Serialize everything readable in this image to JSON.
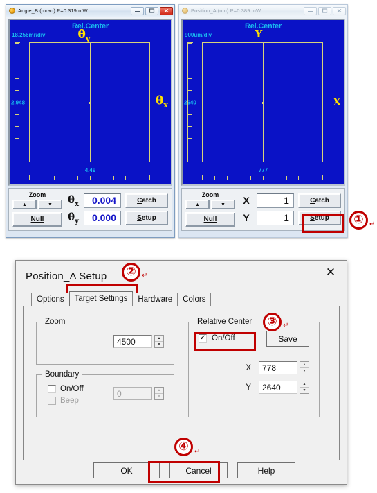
{
  "windows": [
    {
      "id": "angle_b",
      "title": "Angle_B  (mrad)    P=0.319 mW",
      "active": true,
      "scope": {
        "rel_center": "Rel.Center",
        "scale": "18.256mr/div",
        "top_axis_letter": "θ",
        "top_axis_sub": "y",
        "right_axis_letter": "θ",
        "right_axis_sub": "x",
        "y_value": "2.948",
        "x_value": "4.49"
      },
      "panel": {
        "zoom_label": "Zoom",
        "zoom_up": "▲",
        "zoom_down": "▼",
        "null_label": "Null",
        "row1_symbol": "θ",
        "row1_sub": "x",
        "row1_value": "0.004",
        "row2_symbol": "θ",
        "row2_sub": "y",
        "row2_value": "0.000",
        "catch_label": "Catch",
        "setup_label": "Setup"
      }
    },
    {
      "id": "position_a",
      "title": "Position_A  (um)    P=0.389 mW",
      "active": false,
      "scope": {
        "rel_center": "Rel.Center",
        "scale": "900um/div",
        "top_axis_letter": "Y",
        "top_axis_sub": "",
        "right_axis_letter": "X",
        "right_axis_sub": "",
        "y_value": "2640",
        "x_value": "777"
      },
      "panel": {
        "zoom_label": "Zoom",
        "zoom_up": "▲",
        "zoom_down": "▼",
        "null_label": "Null",
        "row1_symbol": "X",
        "row1_sub": "",
        "row1_value": "1",
        "row2_symbol": "Y",
        "row2_sub": "",
        "row2_value": "1",
        "catch_label": "Catch",
        "setup_label": "Setup"
      }
    }
  ],
  "dialog": {
    "title": "Position_A  Setup",
    "close_glyph": "✕",
    "tabs": [
      {
        "label": "Options",
        "selected": false
      },
      {
        "label": "Target Settings",
        "selected": true
      },
      {
        "label": "Hardware",
        "selected": false
      },
      {
        "label": "Colors",
        "selected": false
      }
    ],
    "zoom_group": {
      "legend": "Zoom",
      "value": "4500"
    },
    "boundary_group": {
      "legend": "Boundary",
      "onoff_label": "On/Off",
      "onoff_checked": false,
      "beep_label": "Beep",
      "beep_checked": false,
      "value": "0"
    },
    "relative_center_group": {
      "legend": "Relative Center",
      "onoff_label": "On/Off",
      "onoff_checked": true,
      "check_glyph": "✔",
      "save_label": "Save",
      "x_label": "X",
      "x_value": "778",
      "y_label": "Y",
      "y_value": "2640"
    },
    "buttons": {
      "ok": "OK",
      "cancel": "Cancel",
      "help": "Help"
    }
  },
  "annotations": {
    "steps": [
      {
        "id": "step-1",
        "label": "①"
      },
      {
        "id": "step-2",
        "label": "②"
      },
      {
        "id": "step-3",
        "label": "③"
      },
      {
        "id": "step-4",
        "label": "④"
      }
    ],
    "pilcrow": "↵",
    "highlight_color": "#c00000"
  }
}
